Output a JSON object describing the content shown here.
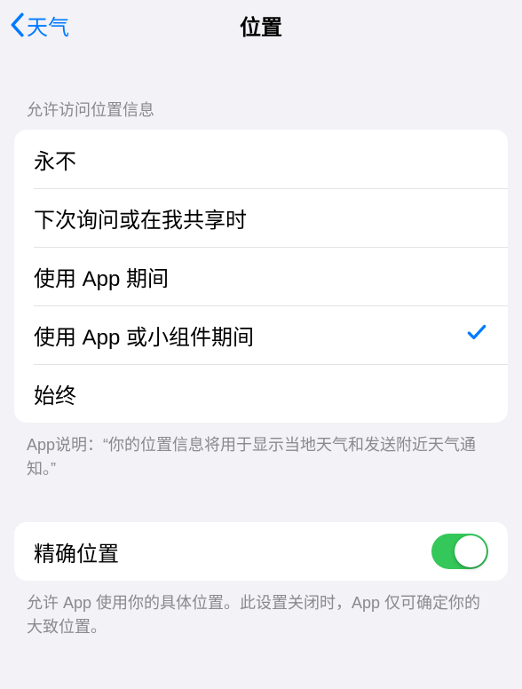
{
  "nav": {
    "back_label": "天气",
    "title": "位置"
  },
  "access": {
    "header": "允许访问位置信息",
    "options": [
      {
        "label": "永不",
        "selected": false
      },
      {
        "label": "下次询问或在我共享时",
        "selected": false
      },
      {
        "label": "使用 App 期间",
        "selected": false
      },
      {
        "label": "使用 App 或小组件期间",
        "selected": true
      },
      {
        "label": "始终",
        "selected": false
      }
    ],
    "footer": "App说明：“你的位置信息将用于显示当地天气和发送附近天气通知。”"
  },
  "precise": {
    "label": "精确位置",
    "enabled": true,
    "footer": "允许 App 使用你的具体位置。此设置关闭时，App 仅可确定你的大致位置。"
  }
}
